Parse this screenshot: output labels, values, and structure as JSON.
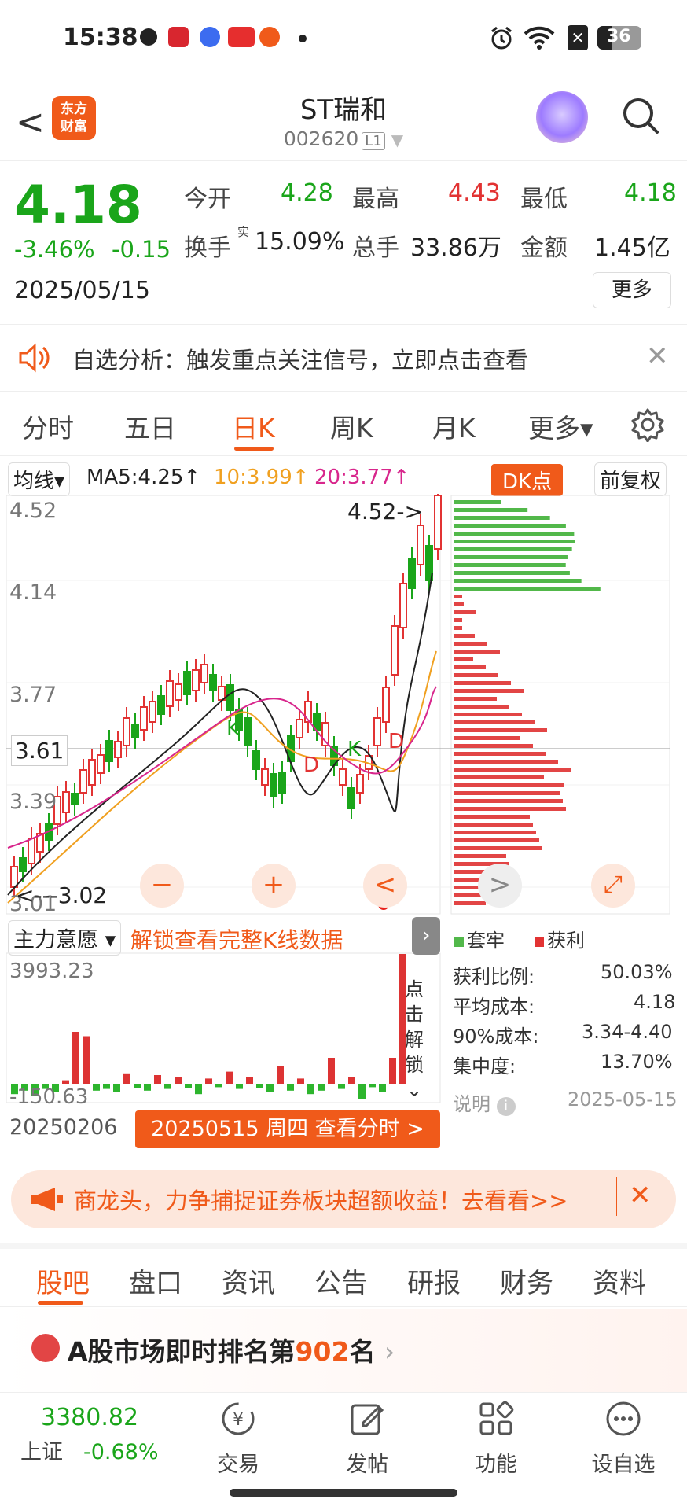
{
  "status_bar": {
    "time": "15:38",
    "battery": "36"
  },
  "header": {
    "back": "<",
    "logo_line1": "东方",
    "logo_line2": "财富",
    "title": "ST瑞和",
    "code": "002620",
    "level": "L1"
  },
  "quote": {
    "price": "4.18",
    "change_pct": "-3.46%",
    "change_amt": "-0.15",
    "date": "2025/05/15",
    "open_label": "今开",
    "open": "4.28",
    "high_label": "最高",
    "high": "4.43",
    "low_label": "最低",
    "low": "4.18",
    "turnover_label": "换手",
    "turnover_sup": "实",
    "turnover": "15.09%",
    "volume_label": "总手",
    "volume": "33.86万",
    "amount_label": "金额",
    "amount": "1.45亿",
    "more": "更多"
  },
  "notice": {
    "text": "自选分析：触发重点关注信号，立即点击查看",
    "close": "✕"
  },
  "tabs": [
    "分时",
    "五日",
    "日K",
    "周K",
    "月K",
    "更多▾"
  ],
  "ma": {
    "type_label": "均线▾",
    "ma5": "MA5:4.25↑",
    "ma10": "10:3.99↑",
    "ma20": "20:3.77↑",
    "dk": "DK点",
    "adjust": "前复权"
  },
  "kline": {
    "y_labels": [
      "4.52",
      "4.14",
      "3.77",
      "3.61",
      "3.39",
      "3.01"
    ],
    "max_marker": "4.52->",
    "min_marker": "<---3.02",
    "markers": [
      "K",
      "D",
      "K",
      "D"
    ],
    "controls": [
      "−",
      "+",
      "<",
      ">",
      "⤢"
    ]
  },
  "indicator": {
    "name": "主力意愿 ▾",
    "unlock": "解锁查看完整K线数据",
    "top_value": "3993.23",
    "bottom_value": "-150.63",
    "unlock_side": [
      "点",
      "击",
      "解",
      "锁"
    ],
    "start_date": "20250206",
    "end_button": "20250515 周四 查看分时 >"
  },
  "chip": {
    "legend_trapped": "套牢",
    "legend_profit": "获利",
    "rows": [
      {
        "label": "获利比例:",
        "value": "50.03%"
      },
      {
        "label": "平均成本:",
        "value": "4.18"
      },
      {
        "label": "90%成本:",
        "value": "3.34-4.40"
      },
      {
        "label": "集中度:",
        "value": "13.70%"
      }
    ],
    "explain": "说明",
    "date": "2025-05-15"
  },
  "banner": {
    "text": "商龙头，力争捕捉证券板块超额收益！去看看>>",
    "close": "✕"
  },
  "bottom_tabs": [
    "股吧",
    "盘口",
    "资讯",
    "公告",
    "研报",
    "财务",
    "资料"
  ],
  "rank": {
    "prefix": "A股市场即时排名第",
    "rank": "902",
    "suffix": "名"
  },
  "nav": {
    "index_value": "3380.82",
    "index_name": "上证",
    "index_change": "-0.68%",
    "items": [
      "交易",
      "发帖",
      "功能",
      "设自选"
    ]
  },
  "colors": {
    "accent": "#f05a1a",
    "up": "#e23333",
    "down": "#1aa51a"
  }
}
